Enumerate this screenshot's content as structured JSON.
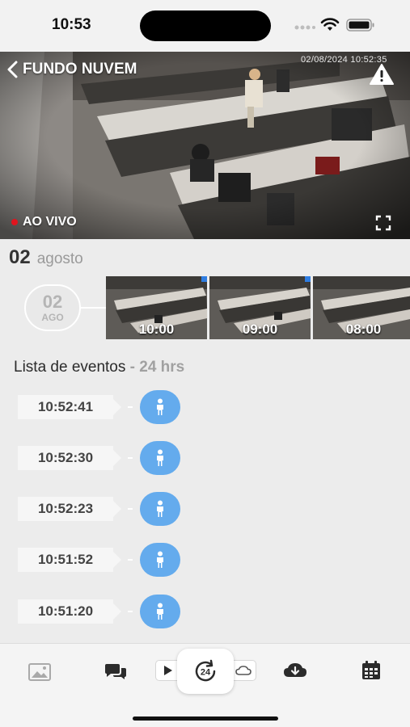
{
  "status_bar": {
    "time": "10:53"
  },
  "camera": {
    "title": "FUNDO NUVEM",
    "timestamp": "02/08/2024 10:52:35",
    "live_label": "AO VIVO",
    "icons": {
      "back": "chevron-left-icon",
      "warning": "warning-triangle-icon",
      "fullscreen": "fullscreen-icon"
    }
  },
  "date_header": {
    "day": "02",
    "month": "agosto"
  },
  "timeline": {
    "day": "02",
    "month_abbr": "AGO",
    "recordings": [
      {
        "time": "10:00"
      },
      {
        "time": "09:00"
      },
      {
        "time": "08:00"
      }
    ]
  },
  "events": {
    "title": "Lista de eventos",
    "subtitle": "- 24 hrs",
    "items": [
      {
        "time": "10:52:41",
        "icon": "person-icon"
      },
      {
        "time": "10:52:30",
        "icon": "person-icon"
      },
      {
        "time": "10:52:23",
        "icon": "person-icon"
      },
      {
        "time": "10:51:52",
        "icon": "person-icon"
      },
      {
        "time": "10:51:20",
        "icon": "person-icon"
      }
    ]
  },
  "tab_bar": {
    "items": [
      "gallery-icon",
      "chat-icon",
      "play-icon",
      "history-24h-icon",
      "cloud-icon",
      "cloud-download-icon",
      "calendar-icon"
    ]
  },
  "colors": {
    "accent": "#64abed",
    "live": "#e0141e",
    "marker": "#2f7de1"
  }
}
